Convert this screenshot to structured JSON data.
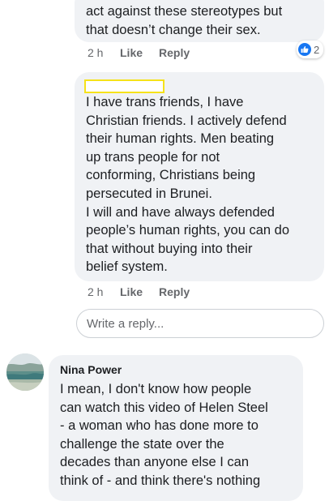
{
  "comments": [
    {
      "text": "act against these stereotypes but\nthat doesn’t change their sex.",
      "time": "2 h",
      "like_label": "Like",
      "reply_label": "Reply",
      "reaction_count": "2"
    },
    {
      "text": "I have trans friends, I have\nChristian friends. I actively defend\ntheir human rights. Men beating\nup trans people for not\nconforming, Christians being\npersecuted in Brunei.\nI will and have always defended\npeople’s human rights, you can do\nthat without buying into their\nbelief system.",
      "time": "2 h",
      "like_label": "Like",
      "reply_label": "Reply"
    },
    {
      "author": "Nina Power",
      "text": "I mean, I don't know how people\ncan watch this video of Helen Steel\n- a woman who has done more to\nchallenge the state over the\ndecades than anyone else I can\nthink of - and think there's nothing"
    }
  ],
  "reply_box": {
    "placeholder": "Write a reply..."
  },
  "colors": {
    "bubble": "#f0f2f5",
    "meta_text": "#65676b",
    "like_blue": "#1877f2",
    "redaction_outline": "#f6e21a"
  },
  "icons": {
    "reaction": "like-thumbs-up-icon",
    "avatar": "avatar-landscape-image"
  }
}
